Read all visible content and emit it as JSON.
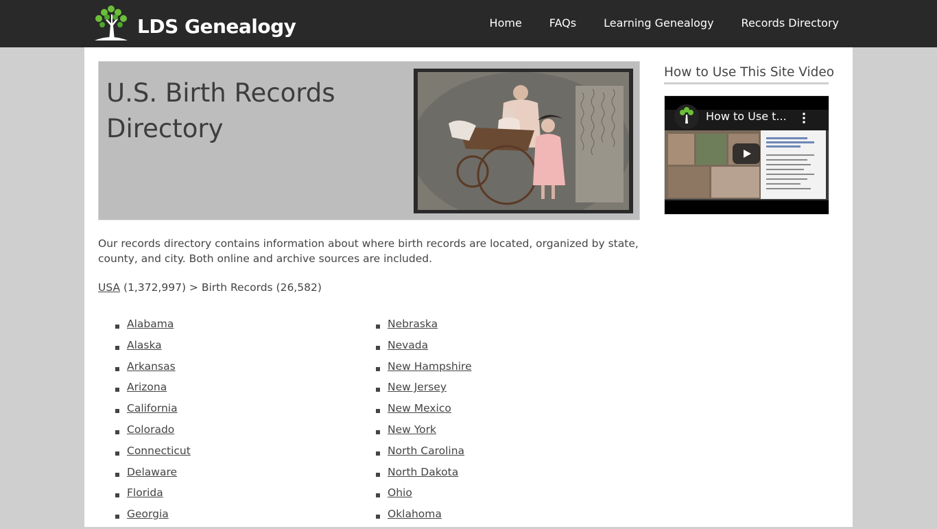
{
  "site": {
    "logo_text": "LDS Genealogy"
  },
  "nav": [
    "Home",
    "FAQs",
    "Learning Genealogy",
    "Records Directory"
  ],
  "hero": {
    "title": "U.S. Birth Records Directory"
  },
  "intro": "Our records directory contains information about where birth records are located, organized by state, county, and city. Both online and archive sources are included.",
  "breadcrumb": {
    "link": "USA",
    "rest": "(1,372,997) > Birth Records (26,582)"
  },
  "states_col1": [
    "Alabama",
    "Alaska",
    "Arkansas",
    "Arizona",
    "California",
    "Colorado",
    "Connecticut",
    "Delaware",
    "Florida",
    "Georgia"
  ],
  "states_col2": [
    "Nebraska",
    "Nevada",
    "New Hampshire",
    "New Jersey",
    "New Mexico",
    "New York",
    "North Carolina",
    "North Dakota",
    "Ohio",
    "Oklahoma"
  ],
  "sidebar": {
    "title": "How to Use This Site Video",
    "video_title": "How to Use t..."
  },
  "colors": {
    "topbar": "#292929",
    "background": "#cfcfcf",
    "hero": "#bdbdbd",
    "logo_leaf": "#6cbf3a"
  }
}
